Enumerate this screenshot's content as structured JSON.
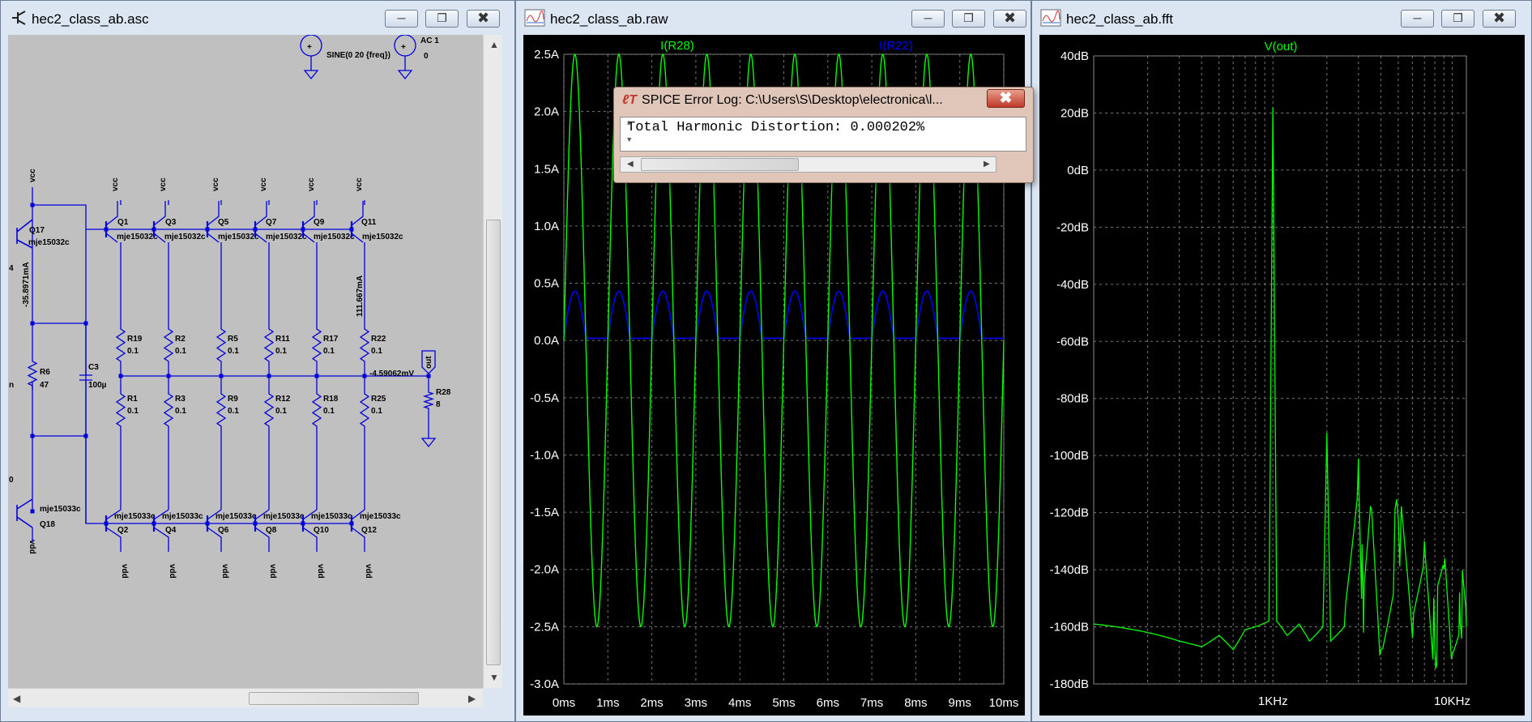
{
  "schematic": {
    "title": "hec2_class_ab.asc",
    "sources": {
      "v1_text": "SINE(0 20 {freq})",
      "v2_text": "AC 1",
      "v2_val": "0"
    },
    "upper_transistors": [
      {
        "name": "Q1",
        "model": "mje15032c"
      },
      {
        "name": "Q3",
        "model": "mje15032c"
      },
      {
        "name": "Q5",
        "model": "mje15032c"
      },
      {
        "name": "Q7",
        "model": "mje15032c"
      },
      {
        "name": "Q9",
        "model": "mje15032c"
      },
      {
        "name": "Q11",
        "model": "mje15032c"
      }
    ],
    "lower_transistors": [
      {
        "name": "Q2",
        "model": "mje15033c"
      },
      {
        "name": "Q4",
        "model": "mje15033c"
      },
      {
        "name": "Q6",
        "model": "mje15033c"
      },
      {
        "name": "Q8",
        "model": "mje15033c"
      },
      {
        "name": "Q10",
        "model": "mje15033c"
      },
      {
        "name": "Q12",
        "model": "mje15033c"
      }
    ],
    "upper_resistors": [
      {
        "name": "R19",
        "value": "0.1"
      },
      {
        "name": "R2",
        "value": "0.1"
      },
      {
        "name": "R5",
        "value": "0.1"
      },
      {
        "name": "R11",
        "value": "0.1"
      },
      {
        "name": "R17",
        "value": "0.1"
      },
      {
        "name": "R22",
        "value": "0.1"
      }
    ],
    "lower_resistors": [
      {
        "name": "R1",
        "value": "0.1"
      },
      {
        "name": "R3",
        "value": "0.1"
      },
      {
        "name": "R9",
        "value": "0.1"
      },
      {
        "name": "R12",
        "value": "0.1"
      },
      {
        "name": "R18",
        "value": "0.1"
      },
      {
        "name": "R25",
        "value": "0.1"
      }
    ],
    "q17": {
      "name": "Q17",
      "model": "mje15032c"
    },
    "q18": {
      "name": "Q18",
      "model": "mje15033c"
    },
    "r6": {
      "name": "R6",
      "value": "47"
    },
    "c3": {
      "name": "C3",
      "value": "100µ"
    },
    "r28": {
      "name": "R28",
      "value": "8"
    },
    "vcc_label": "vcc",
    "vdd_label": "vdd",
    "out_label": "out",
    "current_q17": "-35.8971mA",
    "current_r22": "111.667mA",
    "voltage_out": "-4.59062mV",
    "edge_4": "4",
    "edge_n": "n",
    "edge_0": "0"
  },
  "waveform": {
    "title": "hec2_class_ab.raw",
    "traces": [
      {
        "name": "I(R28)",
        "color": "#00ff00"
      },
      {
        "name": "I(R22)",
        "color": "#0000ff"
      }
    ],
    "y_ticks": [
      "2.5A",
      "2.0A",
      "1.5A",
      "1.0A",
      "0.5A",
      "0.0A",
      "-0.5A",
      "-1.0A",
      "-1.5A",
      "-2.0A",
      "-2.5A",
      "-3.0A"
    ],
    "x_ticks": [
      "0ms",
      "1ms",
      "2ms",
      "3ms",
      "4ms",
      "5ms",
      "6ms",
      "7ms",
      "8ms",
      "9ms",
      "10ms"
    ]
  },
  "fft": {
    "title": "hec2_class_ab.fft",
    "trace": {
      "name": "V(out)",
      "color": "#00ff00"
    },
    "y_ticks": [
      "40dB",
      "20dB",
      "0dB",
      "-20dB",
      "-40dB",
      "-60dB",
      "-80dB",
      "-100dB",
      "-120dB",
      "-140dB",
      "-160dB",
      "-180dB"
    ],
    "x_ticks": [
      "1KHz",
      "10KHz"
    ]
  },
  "chart_data": [
    {
      "type": "line",
      "title": "",
      "xlabel": "",
      "ylabel": "",
      "xlim": [
        0,
        10
      ],
      "x_unit": "ms",
      "ylim": [
        -3.0,
        2.5
      ],
      "y_unit": "A",
      "grid": true,
      "legend": "top",
      "series": [
        {
          "name": "I(R28)",
          "shape": "sine",
          "frequency_khz": 1.0,
          "amplitude": 2.5,
          "offset": 0.0,
          "phase_deg": 0
        },
        {
          "name": "I(R22)",
          "shape": "half-wave-rectified-sine",
          "frequency_khz": 1.0,
          "peak": 0.43,
          "floor": 0.02
        }
      ]
    },
    {
      "type": "line",
      "title": "",
      "xlabel": "",
      "ylabel": "",
      "x_scale": "log",
      "x_unit": "Hz",
      "xlim": [
        100,
        12000
      ],
      "ylim": [
        -180,
        40
      ],
      "y_unit": "dB",
      "grid": true,
      "legend": "top",
      "series": [
        {
          "name": "V(out)",
          "x": [
            100,
            200,
            300,
            400,
            500,
            600,
            700,
            800,
            950,
            1000,
            1050,
            1200,
            1400,
            1600,
            1900,
            2000,
            2100,
            2500,
            3000,
            3200,
            3500,
            4000,
            5000,
            6000,
            7000,
            8000,
            9000,
            10000,
            11000,
            12000
          ],
          "y": [
            -159,
            -162,
            -165,
            -167,
            -163,
            -168,
            -161,
            -160,
            -158,
            22,
            -158,
            -163,
            -159,
            -165,
            -160,
            -92,
            -165,
            -160,
            -101,
            -162,
            -118,
            -168,
            -122,
            -164,
            -130,
            -166,
            -140,
            -170,
            -148,
            -160
          ]
        }
      ]
    }
  ]
}
